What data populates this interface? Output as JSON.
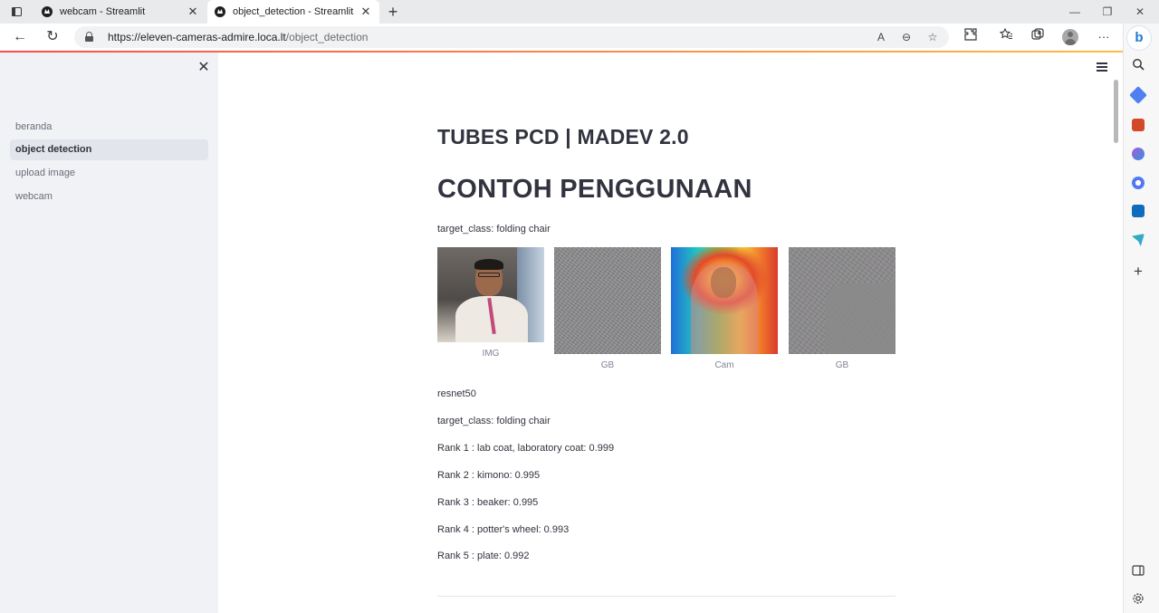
{
  "browser": {
    "tabs": [
      {
        "title": "webcam - Streamlit",
        "close": "✕"
      },
      {
        "title": "object_detection - Streamlit",
        "close": "✕"
      }
    ],
    "new_tab": "+",
    "window_controls": {
      "minimize": "—",
      "restore": "❐",
      "close": "✕"
    },
    "nav": {
      "back": "←",
      "reload": "↻",
      "more": "···"
    },
    "address": {
      "host": "https://eleven-cameras-admire.loca.lt",
      "path": "/object_detection"
    },
    "omnibox_icons": {
      "read_aloud": "A",
      "zoom": "⊖",
      "favorite": "☆"
    },
    "edge_sidebar_add": "+",
    "bing_label": "b"
  },
  "sidebar": {
    "close": "✕",
    "items": [
      {
        "label": "beranda"
      },
      {
        "label": "object detection",
        "active": true
      },
      {
        "label": "upload image"
      },
      {
        "label": "webcam"
      }
    ]
  },
  "main": {
    "subtitle": "TUBES PCD | MADEV 2.0",
    "title": "CONTOH PENGGUNAAN",
    "target_class_top": "target_class: folding chair",
    "images": [
      {
        "caption": "IMG"
      },
      {
        "caption": "GB"
      },
      {
        "caption": "Cam"
      },
      {
        "caption": "GB"
      }
    ],
    "model": "resnet50",
    "target_class": "target_class: folding chair",
    "ranks": [
      "Rank 1 : lab coat, laboratory coat: 0.999",
      "Rank 2 : kimono: 0.995",
      "Rank 3 : beaker: 0.995",
      "Rank 4 : potter's wheel: 0.993",
      "Rank 5 : plate: 0.992"
    ]
  },
  "colors": {
    "accent_red": "#ff4b4b",
    "accent_gold": "#ffbd45",
    "sidebar_bg": "#f0f2f6",
    "text": "#31333f"
  }
}
